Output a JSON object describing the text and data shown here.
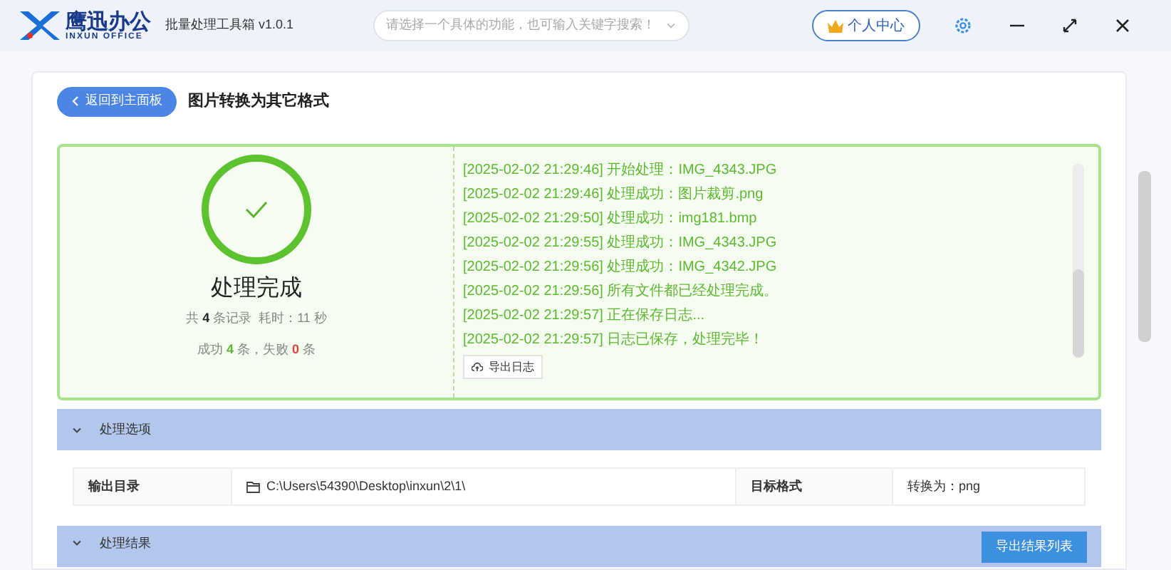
{
  "app": {
    "logo_name": "鹰迅办公",
    "logo_sub": "INXUN OFFICE",
    "product": "批量处理工具箱 v1.0.1"
  },
  "search": {
    "placeholder": "请选择一个具体的功能，也可输入关键字搜索！"
  },
  "user_button": "个人中心",
  "page": {
    "back_button": "返回到主面板",
    "title": "图片转换为其它格式"
  },
  "result": {
    "title": "处理完成",
    "total_prefix": "共",
    "total": "4",
    "total_suffix": "条记录",
    "time_label": "耗时：",
    "time": "11 秒",
    "success_prefix": "成功",
    "success": "4",
    "success_suffix": "条，失败",
    "failed": "0",
    "failed_suffix": "条"
  },
  "log": [
    {
      "time": "[2025-02-02 21:29:46]",
      "message": "开始处理：IMG_4343.JPG"
    },
    {
      "time": "[2025-02-02 21:29:46]",
      "message": "处理成功：图片裁剪.png"
    },
    {
      "time": "[2025-02-02 21:29:50]",
      "message": "处理成功：img181.bmp"
    },
    {
      "time": "[2025-02-02 21:29:55]",
      "message": "处理成功：IMG_4343.JPG"
    },
    {
      "time": "[2025-02-02 21:29:56]",
      "message": "处理成功：IMG_4342.JPG"
    },
    {
      "time": "[2025-02-02 21:29:56]",
      "message": "所有文件都已经处理完成。"
    },
    {
      "time": "[2025-02-02 21:29:57]",
      "message": "正在保存日志..."
    },
    {
      "time": "[2025-02-02 21:29:57]",
      "message": "日志已保存，处理完毕！"
    }
  ],
  "export_log_button": "导出日志",
  "options": {
    "title": "处理选项",
    "expanded": true,
    "output_label": "输出目录",
    "output_path": "C:\\Users\\54390\\Desktop\\inxun\\2\\1\\",
    "format_label": "目标格式",
    "format_value": "转换为：png"
  },
  "results": {
    "title": "处理结果",
    "expanded": true,
    "export_button": "导出结果列表"
  }
}
